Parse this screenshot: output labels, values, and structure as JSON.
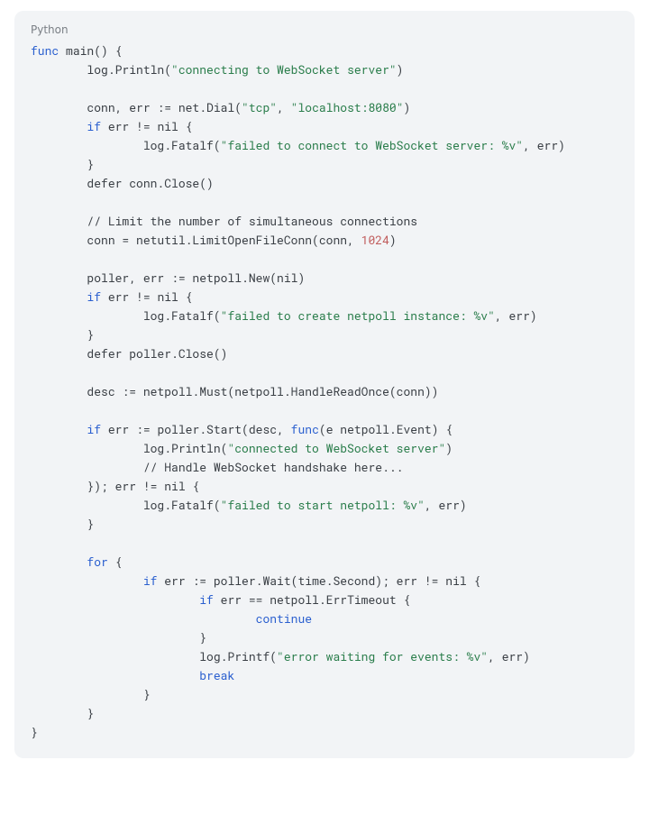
{
  "code": {
    "language_label": "Python",
    "tokens": [
      [
        [
          "kw",
          "func"
        ],
        [
          "p",
          " main() {"
        ]
      ],
      [
        [
          "p",
          "        log.Println("
        ],
        [
          "str",
          "\"connecting to WebSocket server\""
        ],
        [
          "p",
          ")"
        ]
      ],
      [
        [
          "p",
          ""
        ]
      ],
      [
        [
          "p",
          "        conn, err := net.Dial("
        ],
        [
          "str",
          "\"tcp\""
        ],
        [
          "p",
          ", "
        ],
        [
          "str",
          "\"localhost:8080\""
        ],
        [
          "p",
          ")"
        ]
      ],
      [
        [
          "p",
          "        "
        ],
        [
          "kw",
          "if"
        ],
        [
          "p",
          " err != nil {"
        ]
      ],
      [
        [
          "p",
          "                log.Fatalf("
        ],
        [
          "str",
          "\"failed to connect to WebSocket server: %v\""
        ],
        [
          "p",
          ", err)"
        ]
      ],
      [
        [
          "p",
          "        }"
        ]
      ],
      [
        [
          "p",
          "        defer conn.Close()"
        ]
      ],
      [
        [
          "p",
          ""
        ]
      ],
      [
        [
          "p",
          "        // Limit the number of simultaneous connections"
        ]
      ],
      [
        [
          "p",
          "        conn = netutil.LimitOpenFileConn(conn, "
        ],
        [
          "num",
          "1024"
        ],
        [
          "p",
          ")"
        ]
      ],
      [
        [
          "p",
          ""
        ]
      ],
      [
        [
          "p",
          "        poller, err := netpoll.New(nil)"
        ]
      ],
      [
        [
          "p",
          "        "
        ],
        [
          "kw",
          "if"
        ],
        [
          "p",
          " err != nil {"
        ]
      ],
      [
        [
          "p",
          "                log.Fatalf("
        ],
        [
          "str",
          "\"failed to create netpoll instance: %v\""
        ],
        [
          "p",
          ", err)"
        ]
      ],
      [
        [
          "p",
          "        }"
        ]
      ],
      [
        [
          "p",
          "        defer poller.Close()"
        ]
      ],
      [
        [
          "p",
          ""
        ]
      ],
      [
        [
          "p",
          "        desc := netpoll.Must(netpoll.HandleReadOnce(conn))"
        ]
      ],
      [
        [
          "p",
          ""
        ]
      ],
      [
        [
          "p",
          "        "
        ],
        [
          "kw",
          "if"
        ],
        [
          "p",
          " err := poller.Start(desc, "
        ],
        [
          "kw",
          "func"
        ],
        [
          "p",
          "(e netpoll.Event) {"
        ]
      ],
      [
        [
          "p",
          "                log.Println("
        ],
        [
          "str",
          "\"connected to WebSocket server\""
        ],
        [
          "p",
          ")"
        ]
      ],
      [
        [
          "p",
          "                // Handle WebSocket handshake here..."
        ]
      ],
      [
        [
          "p",
          "        }); err != nil {"
        ]
      ],
      [
        [
          "p",
          "                log.Fatalf("
        ],
        [
          "str",
          "\"failed to start netpoll: %v\""
        ],
        [
          "p",
          ", err)"
        ]
      ],
      [
        [
          "p",
          "        }"
        ]
      ],
      [
        [
          "p",
          ""
        ]
      ],
      [
        [
          "p",
          "        "
        ],
        [
          "kw",
          "for"
        ],
        [
          "p",
          " {"
        ]
      ],
      [
        [
          "p",
          "                "
        ],
        [
          "kw",
          "if"
        ],
        [
          "p",
          " err := poller.Wait(time.Second); err != nil {"
        ]
      ],
      [
        [
          "p",
          "                        "
        ],
        [
          "kw",
          "if"
        ],
        [
          "p",
          " err == netpoll.ErrTimeout {"
        ]
      ],
      [
        [
          "p",
          "                                "
        ],
        [
          "kw",
          "continue"
        ]
      ],
      [
        [
          "p",
          "                        }"
        ]
      ],
      [
        [
          "p",
          "                        log.Printf("
        ],
        [
          "str",
          "\"error waiting for events: %v\""
        ],
        [
          "p",
          ", err)"
        ]
      ],
      [
        [
          "p",
          "                        "
        ],
        [
          "kw",
          "break"
        ]
      ],
      [
        [
          "p",
          "                }"
        ]
      ],
      [
        [
          "p",
          "        }"
        ]
      ],
      [
        [
          "p",
          "}"
        ]
      ]
    ]
  }
}
